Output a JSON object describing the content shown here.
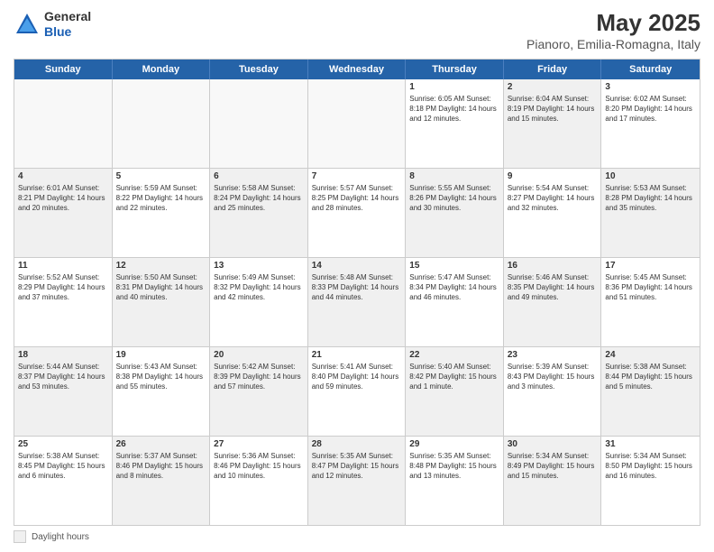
{
  "header": {
    "logo_line1": "General",
    "logo_line2": "Blue",
    "title": "May 2025",
    "subtitle": "Pianoro, Emilia-Romagna, Italy"
  },
  "days_of_week": [
    "Sunday",
    "Monday",
    "Tuesday",
    "Wednesday",
    "Thursday",
    "Friday",
    "Saturday"
  ],
  "weeks": [
    {
      "cells": [
        {
          "day": "",
          "info": "",
          "shaded": false,
          "empty": true
        },
        {
          "day": "",
          "info": "",
          "shaded": false,
          "empty": true
        },
        {
          "day": "",
          "info": "",
          "shaded": false,
          "empty": true
        },
        {
          "day": "",
          "info": "",
          "shaded": false,
          "empty": true
        },
        {
          "day": "1",
          "info": "Sunrise: 6:05 AM\nSunset: 8:18 PM\nDaylight: 14 hours\nand 12 minutes.",
          "shaded": false
        },
        {
          "day": "2",
          "info": "Sunrise: 6:04 AM\nSunset: 8:19 PM\nDaylight: 14 hours\nand 15 minutes.",
          "shaded": true
        },
        {
          "day": "3",
          "info": "Sunrise: 6:02 AM\nSunset: 8:20 PM\nDaylight: 14 hours\nand 17 minutes.",
          "shaded": false
        }
      ]
    },
    {
      "cells": [
        {
          "day": "4",
          "info": "Sunrise: 6:01 AM\nSunset: 8:21 PM\nDaylight: 14 hours\nand 20 minutes.",
          "shaded": true
        },
        {
          "day": "5",
          "info": "Sunrise: 5:59 AM\nSunset: 8:22 PM\nDaylight: 14 hours\nand 22 minutes.",
          "shaded": false
        },
        {
          "day": "6",
          "info": "Sunrise: 5:58 AM\nSunset: 8:24 PM\nDaylight: 14 hours\nand 25 minutes.",
          "shaded": true
        },
        {
          "day": "7",
          "info": "Sunrise: 5:57 AM\nSunset: 8:25 PM\nDaylight: 14 hours\nand 28 minutes.",
          "shaded": false
        },
        {
          "day": "8",
          "info": "Sunrise: 5:55 AM\nSunset: 8:26 PM\nDaylight: 14 hours\nand 30 minutes.",
          "shaded": true
        },
        {
          "day": "9",
          "info": "Sunrise: 5:54 AM\nSunset: 8:27 PM\nDaylight: 14 hours\nand 32 minutes.",
          "shaded": false
        },
        {
          "day": "10",
          "info": "Sunrise: 5:53 AM\nSunset: 8:28 PM\nDaylight: 14 hours\nand 35 minutes.",
          "shaded": true
        }
      ]
    },
    {
      "cells": [
        {
          "day": "11",
          "info": "Sunrise: 5:52 AM\nSunset: 8:29 PM\nDaylight: 14 hours\nand 37 minutes.",
          "shaded": false
        },
        {
          "day": "12",
          "info": "Sunrise: 5:50 AM\nSunset: 8:31 PM\nDaylight: 14 hours\nand 40 minutes.",
          "shaded": true
        },
        {
          "day": "13",
          "info": "Sunrise: 5:49 AM\nSunset: 8:32 PM\nDaylight: 14 hours\nand 42 minutes.",
          "shaded": false
        },
        {
          "day": "14",
          "info": "Sunrise: 5:48 AM\nSunset: 8:33 PM\nDaylight: 14 hours\nand 44 minutes.",
          "shaded": true
        },
        {
          "day": "15",
          "info": "Sunrise: 5:47 AM\nSunset: 8:34 PM\nDaylight: 14 hours\nand 46 minutes.",
          "shaded": false
        },
        {
          "day": "16",
          "info": "Sunrise: 5:46 AM\nSunset: 8:35 PM\nDaylight: 14 hours\nand 49 minutes.",
          "shaded": true
        },
        {
          "day": "17",
          "info": "Sunrise: 5:45 AM\nSunset: 8:36 PM\nDaylight: 14 hours\nand 51 minutes.",
          "shaded": false
        }
      ]
    },
    {
      "cells": [
        {
          "day": "18",
          "info": "Sunrise: 5:44 AM\nSunset: 8:37 PM\nDaylight: 14 hours\nand 53 minutes.",
          "shaded": true
        },
        {
          "day": "19",
          "info": "Sunrise: 5:43 AM\nSunset: 8:38 PM\nDaylight: 14 hours\nand 55 minutes.",
          "shaded": false
        },
        {
          "day": "20",
          "info": "Sunrise: 5:42 AM\nSunset: 8:39 PM\nDaylight: 14 hours\nand 57 minutes.",
          "shaded": true
        },
        {
          "day": "21",
          "info": "Sunrise: 5:41 AM\nSunset: 8:40 PM\nDaylight: 14 hours\nand 59 minutes.",
          "shaded": false
        },
        {
          "day": "22",
          "info": "Sunrise: 5:40 AM\nSunset: 8:42 PM\nDaylight: 15 hours\nand 1 minute.",
          "shaded": true
        },
        {
          "day": "23",
          "info": "Sunrise: 5:39 AM\nSunset: 8:43 PM\nDaylight: 15 hours\nand 3 minutes.",
          "shaded": false
        },
        {
          "day": "24",
          "info": "Sunrise: 5:38 AM\nSunset: 8:44 PM\nDaylight: 15 hours\nand 5 minutes.",
          "shaded": true
        }
      ]
    },
    {
      "cells": [
        {
          "day": "25",
          "info": "Sunrise: 5:38 AM\nSunset: 8:45 PM\nDaylight: 15 hours\nand 6 minutes.",
          "shaded": false
        },
        {
          "day": "26",
          "info": "Sunrise: 5:37 AM\nSunset: 8:46 PM\nDaylight: 15 hours\nand 8 minutes.",
          "shaded": true
        },
        {
          "day": "27",
          "info": "Sunrise: 5:36 AM\nSunset: 8:46 PM\nDaylight: 15 hours\nand 10 minutes.",
          "shaded": false
        },
        {
          "day": "28",
          "info": "Sunrise: 5:35 AM\nSunset: 8:47 PM\nDaylight: 15 hours\nand 12 minutes.",
          "shaded": true
        },
        {
          "day": "29",
          "info": "Sunrise: 5:35 AM\nSunset: 8:48 PM\nDaylight: 15 hours\nand 13 minutes.",
          "shaded": false
        },
        {
          "day": "30",
          "info": "Sunrise: 5:34 AM\nSunset: 8:49 PM\nDaylight: 15 hours\nand 15 minutes.",
          "shaded": true
        },
        {
          "day": "31",
          "info": "Sunrise: 5:34 AM\nSunset: 8:50 PM\nDaylight: 15 hours\nand 16 minutes.",
          "shaded": false
        }
      ]
    }
  ],
  "legend": {
    "label": "Daylight hours"
  }
}
